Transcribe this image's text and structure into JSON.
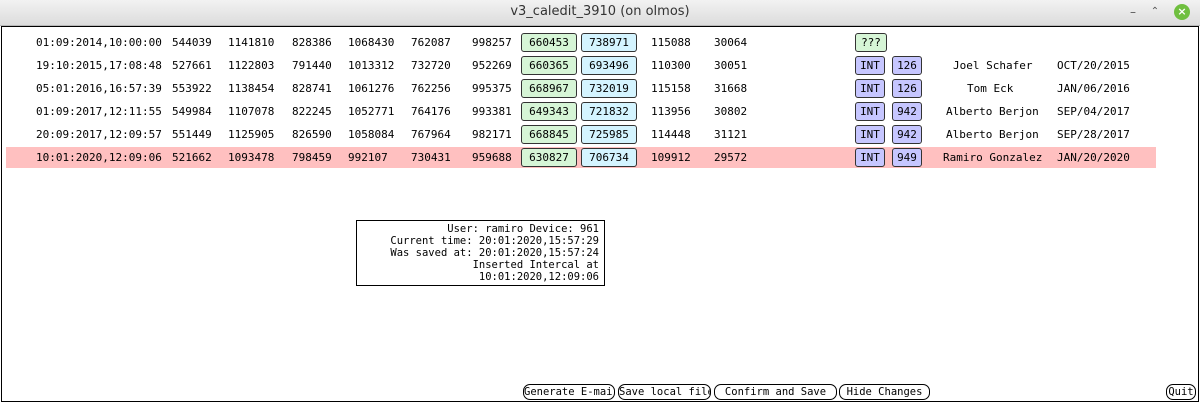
{
  "window": {
    "title": "v3_caledit_3910 (on olmos)",
    "min_label": "–",
    "max_label": "⌃",
    "close_label": "×"
  },
  "rows": [
    {
      "date": "01:09:2014,10:00:00",
      "c1": "544039",
      "c2": "1141810",
      "c3": "828386",
      "c4": "1068430",
      "c5": "762087",
      "c6": "998257",
      "g": "660453",
      "b": "738971",
      "c7": "115088",
      "c8": "30064",
      "tag": "???",
      "dev": "",
      "name": "",
      "dt": ""
    },
    {
      "date": "19:10:2015,17:08:48",
      "c1": "527661",
      "c2": "1122803",
      "c3": "791440",
      "c4": "1013312",
      "c5": "732720",
      "c6": "952269",
      "g": "660365",
      "b": "693496",
      "c7": "110300",
      "c8": "30051",
      "tag": "INT",
      "dev": "126",
      "name": "Joel Schafer",
      "dt": "OCT/20/2015"
    },
    {
      "date": "05:01:2016,16:57:39",
      "c1": "553922",
      "c2": "1138454",
      "c3": "828741",
      "c4": "1061276",
      "c5": "762256",
      "c6": "995375",
      "g": "668967",
      "b": "732019",
      "c7": "115158",
      "c8": "31668",
      "tag": "INT",
      "dev": "126",
      "name": "Tom Eck",
      "dt": "JAN/06/2016"
    },
    {
      "date": "01:09:2017,12:11:55",
      "c1": "549984",
      "c2": "1107078",
      "c3": "822245",
      "c4": "1052771",
      "c5": "764176",
      "c6": "993381",
      "g": "649343",
      "b": "721832",
      "c7": "113956",
      "c8": "30802",
      "tag": "INT",
      "dev": "942",
      "name": "Alberto Berjon",
      "dt": "SEP/04/2017"
    },
    {
      "date": "20:09:2017,12:09:57",
      "c1": "551449",
      "c2": "1125905",
      "c3": "826590",
      "c4": "1058084",
      "c5": "767964",
      "c6": "982171",
      "g": "668845",
      "b": "725985",
      "c7": "114448",
      "c8": "31121",
      "tag": "INT",
      "dev": "942",
      "name": "Alberto Berjon",
      "dt": "SEP/28/2017"
    },
    {
      "date": "10:01:2020,12:09:06",
      "c1": "521662",
      "c2": "1093478",
      "c3": "798459",
      "c4": "992107",
      "c5": "730431",
      "c6": "959688",
      "g": "630827",
      "b": "706734",
      "c7": "109912",
      "c8": "29572",
      "tag": "INT",
      "dev": "949",
      "name": "Ramiro Gonzalez",
      "dt": "JAN/20/2020"
    }
  ],
  "info": {
    "user": "User: ramiro Device: 961",
    "current": "Current time: 20:01:2020,15:57:29",
    "saved": "Was saved at: 20:01:2020,15:57:24",
    "inserted": "Inserted Intercal at 10:01:2020,12:09:06"
  },
  "buttons": {
    "email": "Generate E-mail",
    "save_local": "Save local file",
    "confirm": "Confirm and Save",
    "hide": "Hide Changes",
    "quit": "Quit"
  },
  "colors": {
    "highlight_row": "#ffc0c0",
    "green_box": "#d6f5d6",
    "cyan_box": "#d4f4ff",
    "blue_box": "#c6c6ff"
  }
}
